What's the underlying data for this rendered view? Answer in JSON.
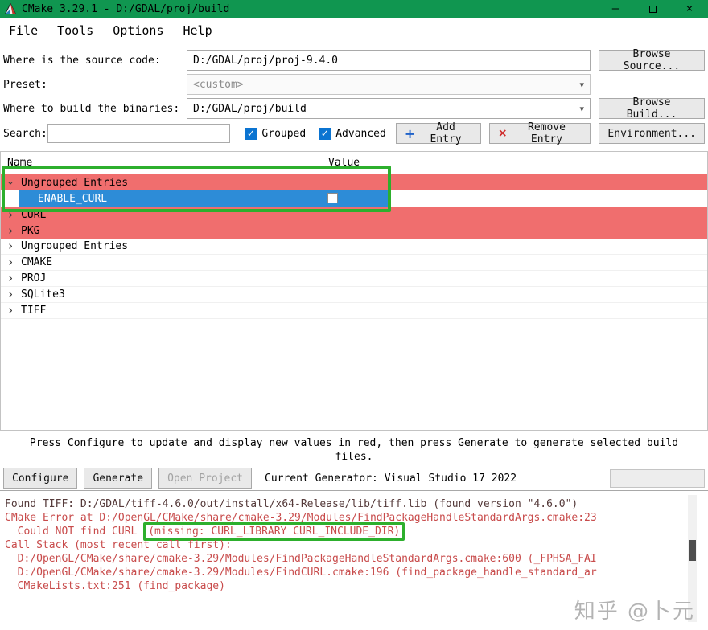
{
  "colors": {
    "titlebar": "#109650",
    "row_red": "#f06e6e",
    "selection": "#2d8cd7",
    "annotation": "#2daf2d",
    "error": "#c84b4b",
    "info": "#553a3a"
  },
  "icons": {
    "dropdown": "▾",
    "check": "✓",
    "chevron": "›",
    "add": "+",
    "remove": "×",
    "minimize": "–",
    "close": "×"
  },
  "window": {
    "title": "CMake 3.29.1 - D:/GDAL/proj/build"
  },
  "menu": {
    "items": [
      "File",
      "Tools",
      "Options",
      "Help"
    ]
  },
  "form": {
    "source_label": "Where is the source code:",
    "source_value": "D:/GDAL/proj/proj-9.4.0",
    "browse_source_label": "Browse Source...",
    "preset_label": "Preset:",
    "preset_value": "<custom>",
    "build_label": "Where to build the binaries:",
    "build_value": "D:/GDAL/proj/build",
    "browse_build_label": "Browse Build..."
  },
  "search": {
    "label": "Search:",
    "value": "",
    "grouped_label": "Grouped",
    "advanced_label": "Advanced",
    "add_entry_label": "Add Entry",
    "remove_entry_label": "Remove Entry",
    "environment_label": "Environment..."
  },
  "table": {
    "columns": [
      "Name",
      "Value"
    ],
    "rows": [
      {
        "name": "Ungrouped Entries",
        "bg": "red",
        "expanded": true
      },
      {
        "name": "ENABLE_CURL",
        "selected": true,
        "value_checkbox": "unchecked"
      },
      {
        "name": "CURL",
        "bg": "red"
      },
      {
        "name": "PKG",
        "bg": "red"
      },
      {
        "name": "Ungrouped Entries",
        "bg": "white"
      },
      {
        "name": "CMAKE",
        "bg": "white"
      },
      {
        "name": "PROJ",
        "bg": "white"
      },
      {
        "name": "SQLite3",
        "bg": "white"
      },
      {
        "name": "TIFF",
        "bg": "white"
      }
    ]
  },
  "help": {
    "line1": "Press Configure to update and display new values in red, then press Generate to generate selected build",
    "line2": "files."
  },
  "actions": {
    "configure_label": "Configure",
    "generate_label": "Generate",
    "open_project_label": "Open Project",
    "generator_text": "Current Generator: Visual Studio 17 2022"
  },
  "log": {
    "lines": [
      {
        "class": "info",
        "segments": [
          {
            "text": "Found TIFF: D:/GDAL/tiff-4.6.0/out/install/x64-Release/lib/tiff.lib (found version \"4.6.0\")"
          }
        ]
      },
      {
        "segments": [
          {
            "text": "CMake Error at "
          },
          {
            "text": "D:/OpenGL/CMake/share/cmake-3.29/Modules/FindPackageHandleStandardArgs.cmake:23",
            "underline": true
          }
        ]
      },
      {
        "segments": [
          {
            "text": "  Could NOT find CURL "
          },
          {
            "text": "(missing: CURL_LIBRARY CURL_INCLUDE_DIR)",
            "boxed": true
          }
        ]
      },
      {
        "segments": [
          {
            "text": "Call Stack (most recent call first):"
          }
        ]
      },
      {
        "segments": [
          {
            "text": "  D:/OpenGL/CMake/share/cmake-3.29/Modules/FindPackageHandleStandardArgs.cmake:600 (_FPHSA_FAI"
          }
        ]
      },
      {
        "segments": [
          {
            "text": "  D:/OpenGL/CMake/share/cmake-3.29/Modules/FindCURL.cmake:196 (find_package_handle_standard_ar"
          }
        ]
      },
      {
        "segments": [
          {
            "text": "  CMakeLists.txt:251 (find_package)"
          }
        ]
      }
    ]
  },
  "watermark": "知乎 @卜元"
}
